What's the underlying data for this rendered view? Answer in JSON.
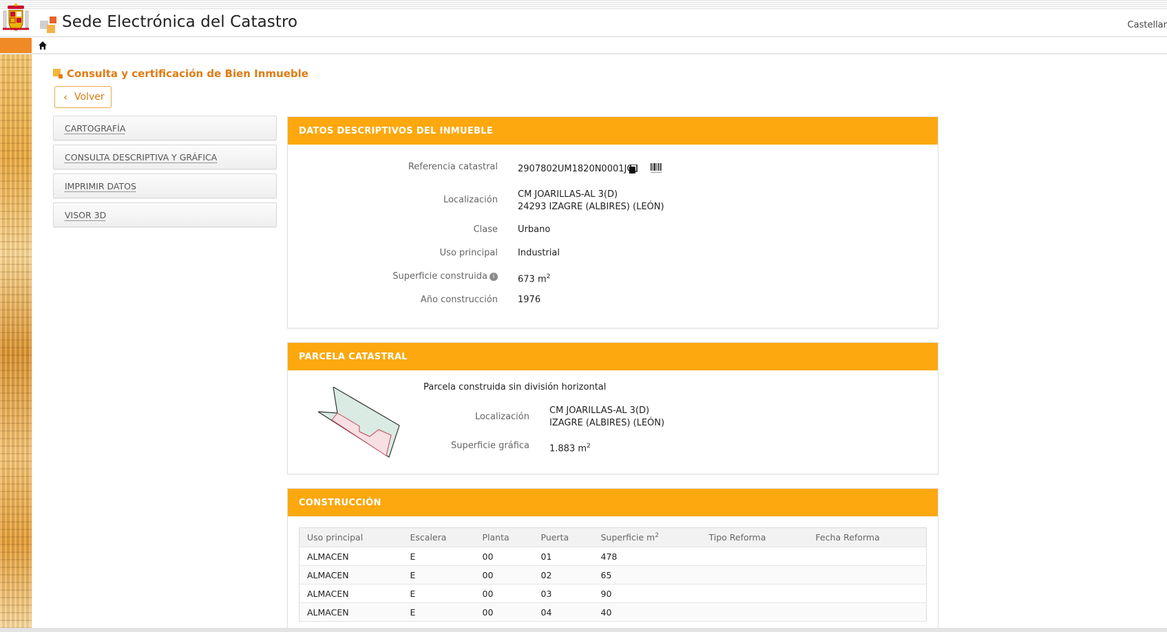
{
  "header": {
    "site_title": "Sede Electrónica del Catastro",
    "language": "Castellar",
    "colors": {
      "accent": "#fca80e",
      "orange_block": "#f08a24",
      "heading": "#e07b12"
    }
  },
  "page": {
    "heading": "Consulta y certificación de Bien Inmueble",
    "back_label": "Volver"
  },
  "menu": {
    "items": [
      {
        "label": "CARTOGRAFÍA"
      },
      {
        "label": "CONSULTA DESCRIPTIVA Y GRÁFICA"
      },
      {
        "label": "IMPRIMIR DATOS"
      },
      {
        "label": "VISOR 3D"
      }
    ]
  },
  "datos": {
    "title": "DATOS DESCRIPTIVOS DEL INMUEBLE",
    "referencia_label": "Referencia catastral",
    "referencia_value": "2907802UM1820N0001JQ",
    "localizacion_label": "Localización",
    "localizacion_line1": "CM JOARILLAS-AL 3(D)",
    "localizacion_line2": "24293 IZAGRE (ALBIRES) (LEÓN)",
    "clase_label": "Clase",
    "clase_value": "Urbano",
    "uso_label": "Uso principal",
    "uso_value": "Industrial",
    "superficie_label": "Superficie construida",
    "superficie_value": "673 m",
    "anio_label": "Año construcción",
    "anio_value": "1976"
  },
  "parcela": {
    "title": "PARCELA CATASTRAL",
    "subtitle": "Parcela construida sin división horizontal",
    "localizacion_label": "Localización",
    "localizacion_line1": "CM JOARILLAS-AL 3(D)",
    "localizacion_line2": "IZAGRE (ALBIRES) (LEÓN)",
    "superficie_label": "Superficie gráfica",
    "superficie_value": "1.883 m"
  },
  "construccion": {
    "title": "CONSTRUCCIÓN",
    "columns": [
      "Uso principal",
      "Escalera",
      "Planta",
      "Puerta",
      "Superficie m",
      "Tipo Reforma",
      "Fecha Reforma"
    ],
    "rows": [
      [
        "ALMACEN",
        "E",
        "00",
        "01",
        "478",
        "",
        ""
      ],
      [
        "ALMACEN",
        "E",
        "00",
        "02",
        "65",
        "",
        ""
      ],
      [
        "ALMACEN",
        "E",
        "00",
        "03",
        "90",
        "",
        ""
      ],
      [
        "ALMACEN",
        "E",
        "00",
        "04",
        "40",
        "",
        ""
      ]
    ]
  },
  "icons": {
    "home": "home-icon",
    "copy": "copy-icon",
    "barcode": "barcode-icon",
    "info": "info-icon",
    "back": "chevron-left-icon"
  }
}
